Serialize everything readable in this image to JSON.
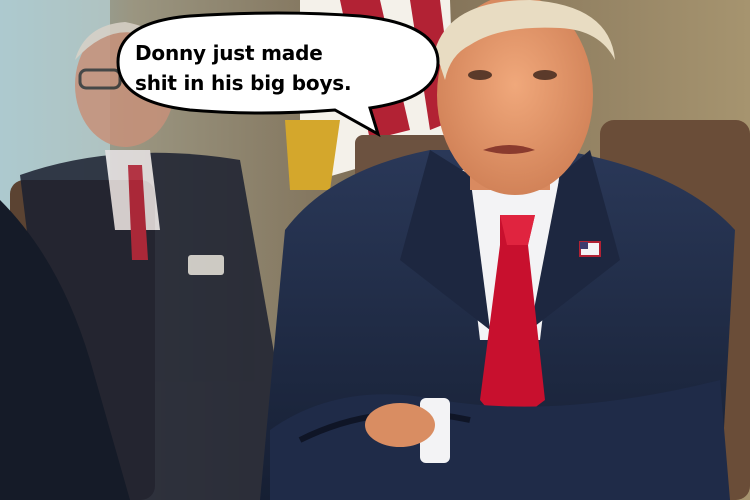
{
  "meme": {
    "caption_line1": "Donny just made",
    "caption_line2": "shit in his big boys."
  },
  "colors": {
    "wall": "#a89a7e",
    "suit": "#1f2a44",
    "tie": "#c8102e",
    "skin": "#e79a6f",
    "hair": "#e8dcc2",
    "bubble_fill": "#ffffff",
    "bubble_stroke": "#000000"
  }
}
